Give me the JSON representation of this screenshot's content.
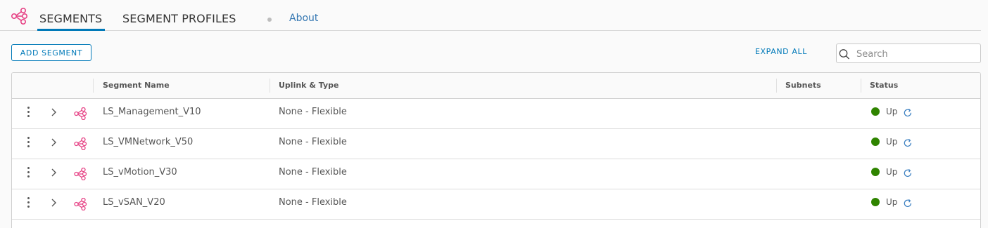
{
  "tabs": {
    "segments": "SEGMENTS",
    "segment_profiles": "SEGMENT PROFILES",
    "about": "About"
  },
  "toolbar": {
    "add_segment": "ADD SEGMENT",
    "expand_all": "EXPAND ALL",
    "search_placeholder": "Search"
  },
  "columns": {
    "name": "Segment Name",
    "uplink": "Uplink & Type",
    "subnets": "Subnets",
    "status": "Status"
  },
  "rows": [
    {
      "name": "LS_Management_V10",
      "uplink": "None - Flexible",
      "subnets": "",
      "status": "Up"
    },
    {
      "name": "LS_VMNetwork_V50",
      "uplink": "None - Flexible",
      "subnets": "",
      "status": "Up"
    },
    {
      "name": "LS_vMotion_V30",
      "uplink": "None - Flexible",
      "subnets": "",
      "status": "Up"
    },
    {
      "name": "LS_vSAN_V20",
      "uplink": "None - Flexible",
      "subnets": "",
      "status": "Up"
    }
  ],
  "colors": {
    "accent": "#0079b8",
    "segment_icon": "#e64285",
    "status_up": "#2f8400"
  },
  "icons": {
    "tab_logo": "segments-icon",
    "row_icon": "segment-icon",
    "search": "search-icon",
    "refresh": "refresh-icon",
    "expand": "chevron-right-icon",
    "menu": "kebab-menu-icon"
  }
}
